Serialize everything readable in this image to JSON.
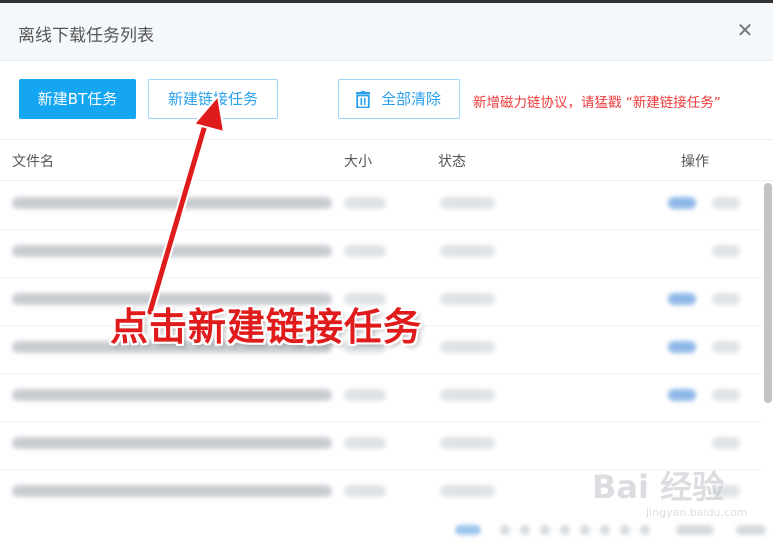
{
  "dialog": {
    "title": "离线下载任务列表",
    "close_icon": "close-icon"
  },
  "toolbar": {
    "new_bt_label": "新建BT任务",
    "new_link_label": "新建链接任务",
    "clear_all_label": "全部清除",
    "clear_icon": "trash-icon",
    "hint": "新增磁力链协议，请猛戳 “新建链接任务”"
  },
  "table": {
    "columns": [
      "文件名",
      "大小",
      "状态",
      "操作"
    ],
    "rows": [
      {
        "has_tag": true
      },
      {
        "has_tag": false
      },
      {
        "has_tag": true
      },
      {
        "has_tag": true
      },
      {
        "has_tag": true
      },
      {
        "has_tag": false
      },
      {
        "has_tag": false
      }
    ]
  },
  "annotation": {
    "text": "点击新建链接任务",
    "arrow_icon": "red-arrow-icon"
  },
  "watermark": {
    "main": "Bai 经验",
    "sub": "jingyan.baidu.com"
  },
  "colors": {
    "primary": "#14a6f1",
    "outline": "#2aa1ec",
    "hint": "#ee3b3b",
    "annotation": "#e01b1b"
  }
}
